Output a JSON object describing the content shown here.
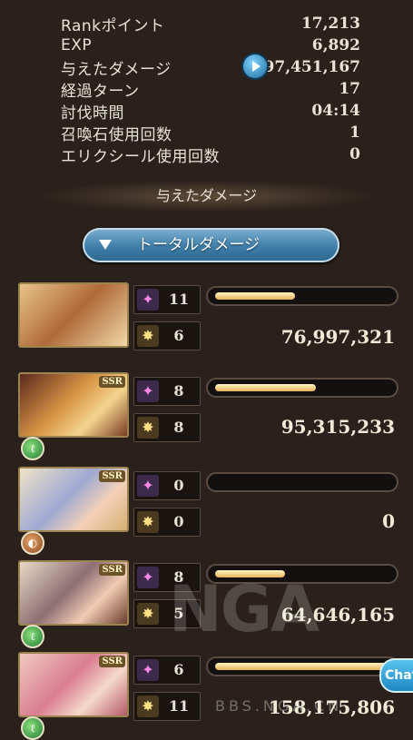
{
  "stats": [
    {
      "label": "Rankポイント",
      "value": "17,213"
    },
    {
      "label": "EXP",
      "value": "6,892"
    },
    {
      "label": "与えたダメージ",
      "value": "397,451,167"
    },
    {
      "label": "経過ターン",
      "value": "17"
    },
    {
      "label": "討伐時間",
      "value": "04:14"
    },
    {
      "label": "召喚石使用回数",
      "value": "1"
    },
    {
      "label": "エリクシール使用回数",
      "value": "0"
    }
  ],
  "section_header": "与えたダメージ",
  "dropdown": {
    "selected": "トータルダメージ"
  },
  "cards": [
    {
      "skill_count": "11",
      "ca_count": "6",
      "damage": "76,997,321",
      "bar_fill": 0.46,
      "element": "none",
      "ssr": false
    },
    {
      "skill_count": "8",
      "ca_count": "8",
      "damage": "95,315,233",
      "bar_fill": 0.58,
      "element": "wind",
      "ssr": true,
      "ssr_label": "SSR"
    },
    {
      "skill_count": "0",
      "ca_count": "0",
      "damage": "0",
      "bar_fill": 0.0,
      "element": "earth",
      "ssr": true,
      "ssr_label": "SSR"
    },
    {
      "skill_count": "8",
      "ca_count": "5",
      "damage": "64,646,165",
      "bar_fill": 0.4,
      "element": "wind",
      "ssr": true,
      "ssr_label": "SSR"
    },
    {
      "skill_count": "6",
      "ca_count": "11",
      "damage": "158,175,806",
      "bar_fill": 1.0,
      "element": "wind",
      "ssr": true,
      "ssr_label": "SSR"
    }
  ],
  "watermark": {
    "logo": "NGA",
    "url": "BBS.NGA.CN"
  },
  "chat_button": "Chat",
  "colors": {
    "accent_blue": "#3e7ea8",
    "bar_gold": "#e7b35a",
    "background": "#2a211c"
  }
}
